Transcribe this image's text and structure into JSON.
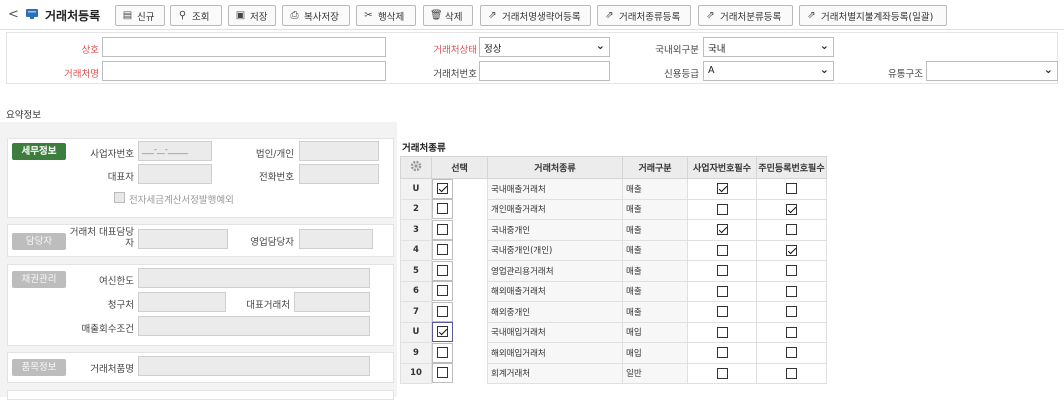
{
  "header": {
    "back_glyph": "<",
    "title": "거래처등록"
  },
  "toolbar": [
    {
      "icon": "▤",
      "label": "신규"
    },
    {
      "icon": "⚲",
      "label": "조회"
    },
    {
      "icon": "▣",
      "label": "저장"
    },
    {
      "icon": "⎙",
      "label": "복사저장"
    },
    {
      "icon": "✂",
      "label": "행삭제"
    },
    {
      "icon": "🗑",
      "label": "삭제"
    },
    {
      "icon": "⇗",
      "label": "거래처명생략어등록"
    },
    {
      "icon": "⇗",
      "label": "거래처종류등록"
    },
    {
      "icon": "⇗",
      "label": "거래처분류등록"
    },
    {
      "icon": "⇗",
      "label": "거래처별지불계좌등록(일괄)"
    }
  ],
  "form": {
    "code_label": "상호",
    "code_value": "",
    "name_label": "거래처명",
    "name_value": "",
    "status_label": "거래처상태",
    "status_value": "정상",
    "number_label": "거래처번호",
    "number_value": "",
    "domestic_label": "국내외구분",
    "domestic_value": "국내",
    "credit_label": "신용등급",
    "credit_value": "A",
    "dist_label": "유통구조",
    "dist_value": ""
  },
  "summary_label": "요약정보",
  "tax": {
    "button": "세무정보",
    "bizno_label": "사업자번호",
    "bizno_mask": "___-__-_____",
    "corp_label": "법인/개인",
    "ceo_label": "대표자",
    "phone_label": "전화번호",
    "einvoice_label": "전자세금계산서정발행예외"
  },
  "manager": {
    "button": "담당자",
    "rep_label": "거래처 대표담당자",
    "sales_label": "영업담당자"
  },
  "credit": {
    "button": "채권관리",
    "limit_label": "여신한도",
    "billing_label": "청구처",
    "parent_label": "대표거래처",
    "terms_label": "매출회수조건"
  },
  "item": {
    "button": "품목정보",
    "name_label": "거래처품명"
  },
  "grid": {
    "title": "거래처종류",
    "headers": [
      "선택",
      "거래처종류",
      "거래구분",
      "사업자번호필수",
      "주민등록번호필수"
    ],
    "rows": [
      {
        "idx": "U",
        "checked": true,
        "type": "국내매출거래처",
        "kind": "매출",
        "biz": true,
        "jumin": false
      },
      {
        "idx": "2",
        "checked": false,
        "type": "개인매출거래처",
        "kind": "매출",
        "biz": false,
        "jumin": true
      },
      {
        "idx": "3",
        "checked": false,
        "type": "국내중개인",
        "kind": "매출",
        "biz": true,
        "jumin": false
      },
      {
        "idx": "4",
        "checked": false,
        "type": "국내중개인(개인)",
        "kind": "매출",
        "biz": false,
        "jumin": true
      },
      {
        "idx": "5",
        "checked": false,
        "type": "영업관리용거래처",
        "kind": "매출",
        "biz": false,
        "jumin": false
      },
      {
        "idx": "6",
        "checked": false,
        "type": "해외매출거래처",
        "kind": "매출",
        "biz": false,
        "jumin": false
      },
      {
        "idx": "7",
        "checked": false,
        "type": "해외중개인",
        "kind": "매출",
        "biz": false,
        "jumin": false
      },
      {
        "idx": "U",
        "checked": true,
        "type": "국내매입거래처",
        "kind": "매입",
        "biz": false,
        "jumin": false
      },
      {
        "idx": "9",
        "checked": false,
        "type": "해외매입거래처",
        "kind": "매입",
        "biz": false,
        "jumin": false
      },
      {
        "idx": "10",
        "checked": false,
        "type": "회계거래처",
        "kind": "일반",
        "biz": false,
        "jumin": false
      }
    ]
  }
}
